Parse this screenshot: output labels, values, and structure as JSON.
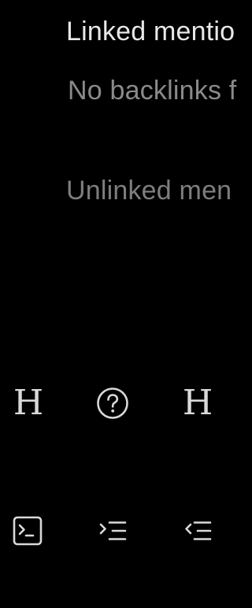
{
  "backlinks": {
    "linked_title": "Linked mentio",
    "no_backlinks_text": "No backlinks f",
    "unlinked_title": "Unlinked men"
  },
  "toolbar_row1": [
    {
      "icon": "heading-icon",
      "glyph": "H"
    },
    {
      "icon": "help-circle-icon",
      "glyph": "?"
    },
    {
      "icon": "heading-icon",
      "glyph": "H"
    }
  ],
  "toolbar_row2": [
    {
      "icon": "terminal-icon"
    },
    {
      "icon": "indent-icon"
    },
    {
      "icon": "outdent-icon"
    }
  ],
  "colors": {
    "background": "#000000",
    "title": "#e8e8e8",
    "muted": "#8a8a8a",
    "icon": "#d9d9d9"
  }
}
